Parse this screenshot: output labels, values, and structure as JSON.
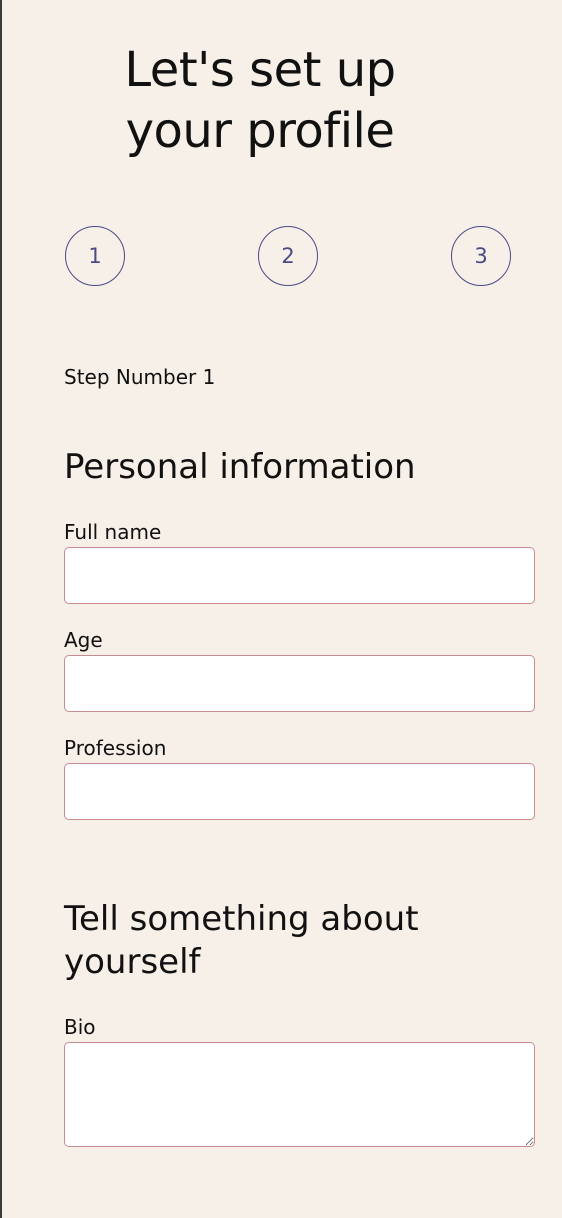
{
  "header": {
    "title": "Let's set up your profile"
  },
  "stepper": {
    "steps": [
      "1",
      "2",
      "3"
    ],
    "current_step_text": "Step Number 1"
  },
  "personal_section": {
    "heading": "Personal information",
    "fields": {
      "full_name": {
        "label": "Full name",
        "value": "",
        "placeholder": ""
      },
      "age": {
        "label": "Age",
        "value": "",
        "placeholder": ""
      },
      "profession": {
        "label": "Profession",
        "value": "",
        "placeholder": ""
      }
    }
  },
  "about_section": {
    "heading": "Tell something about yourself",
    "fields": {
      "bio": {
        "label": "Bio",
        "value": "",
        "placeholder": ""
      }
    }
  },
  "colors": {
    "background": "#f7f0e8",
    "step_accent": "#4a4a86",
    "input_border": "#c98b92"
  }
}
